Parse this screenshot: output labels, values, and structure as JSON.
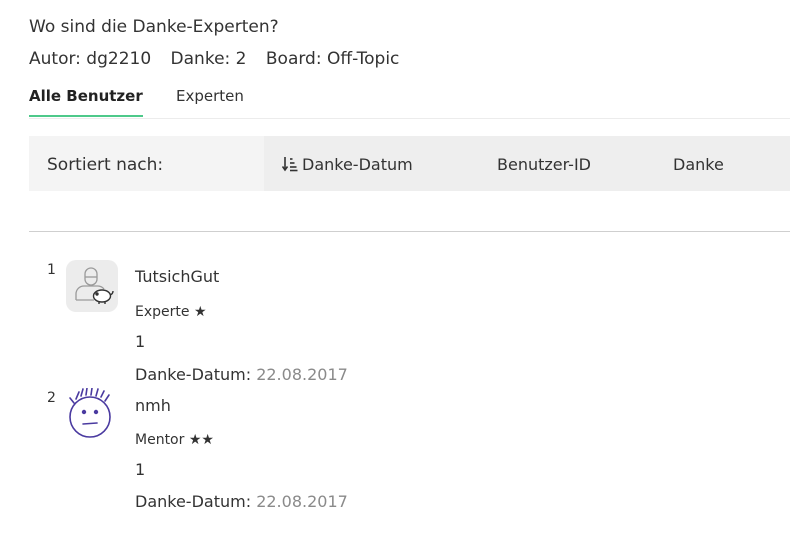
{
  "header": {
    "title": "Wo sind die Danke-Experten?",
    "author": "Autor: dg2210",
    "thanks": "Danke: 2",
    "board": "Board: Off-Topic"
  },
  "tabs": [
    {
      "label": "Alle Benutzer",
      "active": true
    },
    {
      "label": "Experten",
      "active": false
    }
  ],
  "sort": {
    "label": "Sortiert nach:",
    "options": [
      "Danke-Datum",
      "Benutzer-ID",
      "Danke"
    ],
    "active_icon": "sort-descending-icon"
  },
  "colors": {
    "accent": "#4ec98a",
    "muted": "#8a8a8a",
    "avatar_stroke": "#4a3aa0"
  },
  "users": [
    {
      "rank": "1",
      "name": "TutsichGut",
      "rank_title": "Experte ★",
      "count": "1",
      "date_label": "Danke-Datum:",
      "date_value": "22.08.2017",
      "avatar": "default-user-avatar-icon"
    },
    {
      "rank": "2",
      "name": "nmh",
      "rank_title": "Mentor ★★",
      "count": "1",
      "date_label": "Danke-Datum:",
      "date_value": "22.08.2017",
      "avatar": "sketched-face-avatar"
    }
  ]
}
